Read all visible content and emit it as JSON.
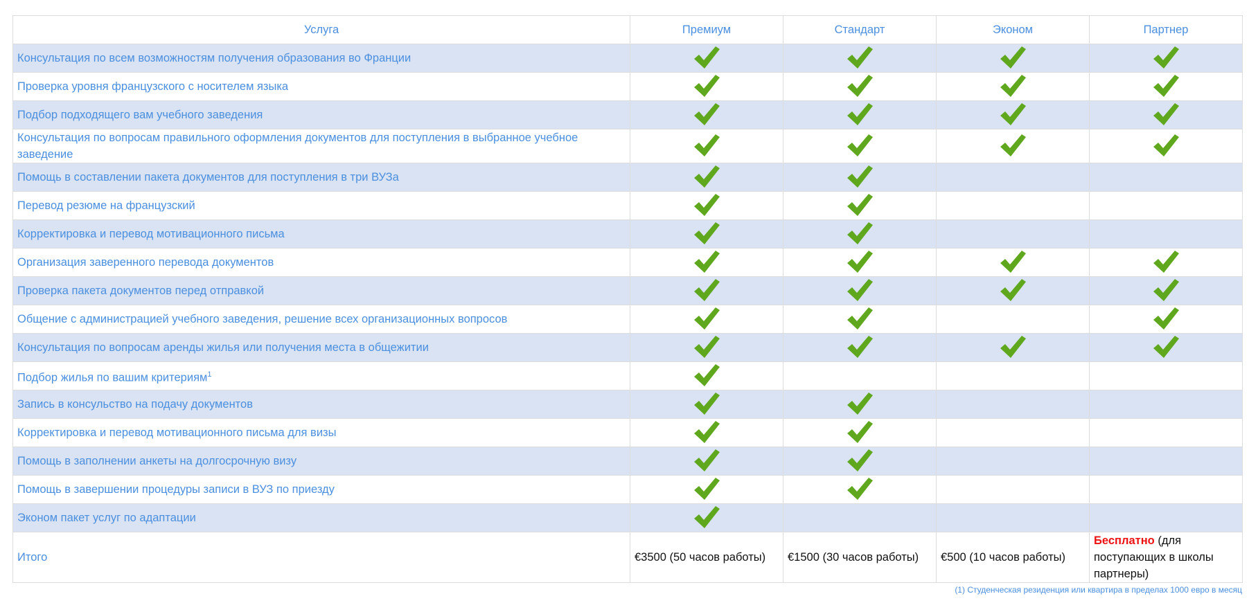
{
  "header": {
    "service": "Услуга",
    "plans": [
      "Премиум",
      "Стандарт",
      "Эконом",
      "Партнер"
    ]
  },
  "rows": [
    {
      "label": "Консультация по всем возможностям получения образования во Франции",
      "checks": [
        true,
        true,
        true,
        true
      ]
    },
    {
      "label": "Проверка уровня французского с носителем языка",
      "checks": [
        true,
        true,
        true,
        true
      ]
    },
    {
      "label": "Подбор подходящего вам учебного заведения",
      "checks": [
        true,
        true,
        true,
        true
      ]
    },
    {
      "label": "Консультация по вопросам правильного оформления документов для поступления в выбранное учебное заведение",
      "checks": [
        true,
        true,
        true,
        true
      ],
      "tall": true
    },
    {
      "label": "Помощь в составлении пакета документов для поступления в три ВУЗа",
      "checks": [
        true,
        true,
        false,
        false
      ]
    },
    {
      "label": "Перевод резюме на французский",
      "checks": [
        true,
        true,
        false,
        false
      ]
    },
    {
      "label": "Корректировка и перевод мотивационного письма",
      "checks": [
        true,
        true,
        false,
        false
      ]
    },
    {
      "label": "Организация заверенного перевода документов",
      "checks": [
        true,
        true,
        true,
        true
      ]
    },
    {
      "label": "Проверка пакета документов перед отправкой",
      "checks": [
        true,
        true,
        true,
        true
      ]
    },
    {
      "label": "Общение с администрацией учебного заведения, решение всех организационных вопросов",
      "checks": [
        true,
        true,
        false,
        true
      ]
    },
    {
      "label": "Консультация по вопросам аренды жилья или получения места в общежитии",
      "checks": [
        true,
        true,
        true,
        true
      ]
    },
    {
      "label": "Подбор жилья по вашим критериям",
      "sup": "1",
      "checks": [
        true,
        false,
        false,
        false
      ]
    },
    {
      "label": "Запись в консульство на подачу документов",
      "checks": [
        true,
        true,
        false,
        false
      ]
    },
    {
      "label": "Корректировка и перевод мотивационного письма для визы",
      "checks": [
        true,
        true,
        false,
        false
      ]
    },
    {
      "label": "Помощь в заполнении анкеты на долгосрочную визу",
      "checks": [
        true,
        true,
        false,
        false
      ]
    },
    {
      "label": "Помощь в завершении процедуры записи в ВУЗ по приезду",
      "checks": [
        true,
        true,
        false,
        false
      ]
    },
    {
      "label": "Эконом пакет услуг по адаптации",
      "checks": [
        true,
        false,
        false,
        false
      ]
    }
  ],
  "total": {
    "label": "Итого",
    "premium": "€3500 (50 часов работы)",
    "standard": "€1500 (30 часов работы)",
    "econom": "€500 (10 часов работы)",
    "partner_free": "Бесплатно",
    "partner_rest": " (для поступающих в школы партнеры)"
  },
  "footnote": "(1) Студенческая резиденция или квартира в пределах 1000 евро в месяц",
  "icons": {
    "check": "check-icon"
  },
  "colors": {
    "link_blue": "#4a8fe0",
    "row_stripe": "#dae3f3",
    "check_green": "#5fa81e",
    "free_red": "#ee1111"
  }
}
